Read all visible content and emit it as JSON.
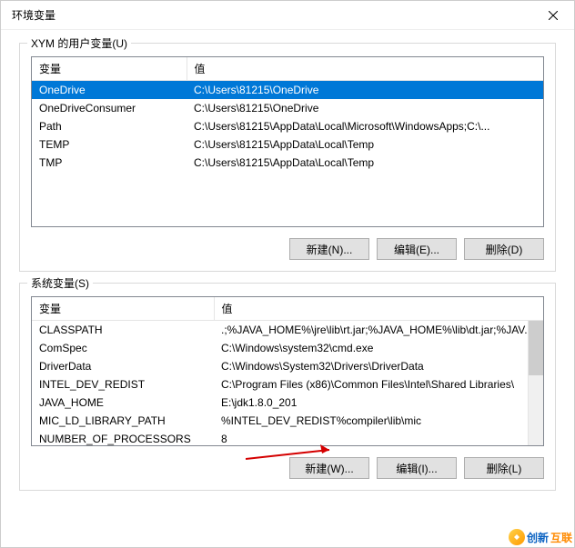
{
  "window": {
    "title": "环境变量"
  },
  "user_group": {
    "label": "XYM 的用户变量(U)",
    "columns": {
      "var": "变量",
      "val": "值"
    },
    "rows": [
      {
        "var": "OneDrive",
        "val": "C:\\Users\\81215\\OneDrive",
        "selected": true
      },
      {
        "var": "OneDriveConsumer",
        "val": "C:\\Users\\81215\\OneDrive",
        "selected": false
      },
      {
        "var": "Path",
        "val": "C:\\Users\\81215\\AppData\\Local\\Microsoft\\WindowsApps;C:\\...",
        "selected": false
      },
      {
        "var": "TEMP",
        "val": "C:\\Users\\81215\\AppData\\Local\\Temp",
        "selected": false
      },
      {
        "var": "TMP",
        "val": "C:\\Users\\81215\\AppData\\Local\\Temp",
        "selected": false
      }
    ],
    "buttons": {
      "new": "新建(N)...",
      "edit": "编辑(E)...",
      "del": "删除(D)"
    }
  },
  "sys_group": {
    "label": "系统变量(S)",
    "columns": {
      "var": "变量",
      "val": "值"
    },
    "rows": [
      {
        "var": "CLASSPATH",
        "val": ".;%JAVA_HOME%\\jre\\lib\\rt.jar;%JAVA_HOME%\\lib\\dt.jar;%JAV..."
      },
      {
        "var": "ComSpec",
        "val": "C:\\Windows\\system32\\cmd.exe"
      },
      {
        "var": "DriverData",
        "val": "C:\\Windows\\System32\\Drivers\\DriverData"
      },
      {
        "var": "INTEL_DEV_REDIST",
        "val": "C:\\Program Files (x86)\\Common Files\\Intel\\Shared Libraries\\"
      },
      {
        "var": "JAVA_HOME",
        "val": "E:\\jdk1.8.0_201"
      },
      {
        "var": "MIC_LD_LIBRARY_PATH",
        "val": "%INTEL_DEV_REDIST%compiler\\lib\\mic"
      },
      {
        "var": "NUMBER_OF_PROCESSORS",
        "val": "8"
      }
    ],
    "buttons": {
      "new": "新建(W)...",
      "edit": "编辑(I)...",
      "del": "删除(L)"
    }
  },
  "watermark": {
    "brand1": "创新",
    "brand2": "互联"
  }
}
